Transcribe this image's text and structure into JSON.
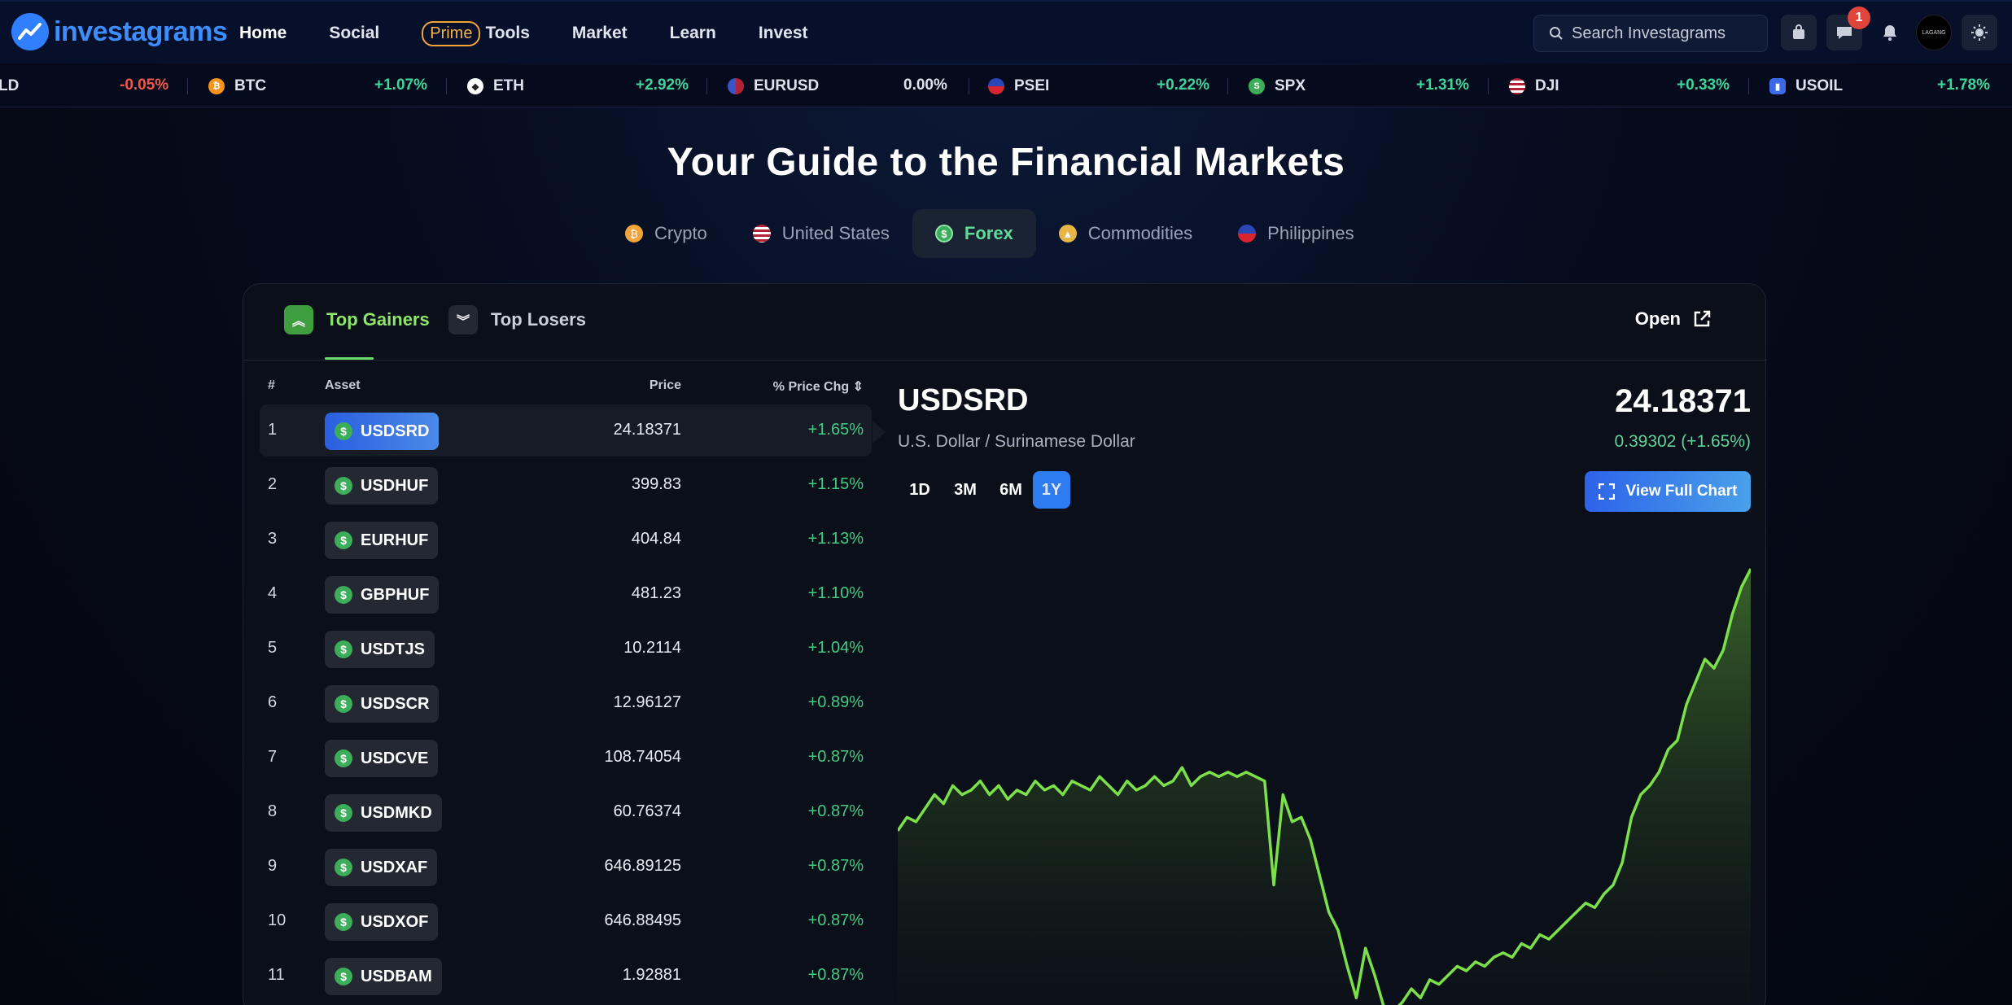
{
  "header": {
    "logo_text": "investagrams",
    "nav": [
      "Home",
      "Social",
      "Prime",
      "Tools",
      "Market",
      "Learn",
      "Invest"
    ],
    "search_placeholder": "Search Investagrams",
    "notification_count": "1",
    "avatar_text": "LAGANG"
  },
  "ticker": [
    {
      "symbol": "LD",
      "change": "-0.05%",
      "icon": "gold-icon",
      "color": "#f0584a"
    },
    {
      "symbol": "BTC",
      "change": "+1.07%",
      "icon": "bitcoin-icon",
      "color": "#f7931a"
    },
    {
      "symbol": "ETH",
      "change": "+2.92%",
      "icon": "ethereum-icon",
      "color": "#ffffff"
    },
    {
      "symbol": "EURUSD",
      "change": "0.00%",
      "icon": "eu-flag-icon",
      "color": "#3a54c8"
    },
    {
      "symbol": "PSEI",
      "change": "+0.22%",
      "icon": "ph-flag-icon",
      "color": "#d8242e"
    },
    {
      "symbol": "SPX",
      "change": "+1.31%",
      "icon": "sp-icon",
      "color": "#3cae5a"
    },
    {
      "symbol": "DJI",
      "change": "+0.33%",
      "icon": "us-flag-icon",
      "color": "#b22234"
    },
    {
      "symbol": "USOIL",
      "change": "+1.78%",
      "icon": "oil-icon",
      "color": "#3a6ae8"
    }
  ],
  "hero": {
    "title": "Your Guide to the Financial Markets"
  },
  "market_tabs": [
    {
      "label": "Crypto",
      "icon": "bitcoin-icon",
      "color": "#f2a33a"
    },
    {
      "label": "United States",
      "icon": "us-flag-icon",
      "color": "#b22234"
    },
    {
      "label": "Forex",
      "icon": "dollar-icon",
      "color": "#3cae5a",
      "active": true
    },
    {
      "label": "Commodities",
      "icon": "gold-icon",
      "color": "#e6b646"
    },
    {
      "label": "Philippines",
      "icon": "ph-flag-icon",
      "color": "#d8242e"
    }
  ],
  "panel": {
    "tabs": [
      "Top Gainers",
      "Top Losers"
    ],
    "open_label": "Open",
    "table_headers": {
      "num": "#",
      "asset": "Asset",
      "price": "Price",
      "chg": "% Price Chg"
    },
    "rows": [
      {
        "num": "1",
        "asset": "USDSRD",
        "price": "24.18371",
        "chg": "+1.65%"
      },
      {
        "num": "2",
        "asset": "USDHUF",
        "price": "399.83",
        "chg": "+1.15%"
      },
      {
        "num": "3",
        "asset": "EURHUF",
        "price": "404.84",
        "chg": "+1.13%"
      },
      {
        "num": "4",
        "asset": "GBPHUF",
        "price": "481.23",
        "chg": "+1.10%"
      },
      {
        "num": "5",
        "asset": "USDTJS",
        "price": "10.2114",
        "chg": "+1.04%"
      },
      {
        "num": "6",
        "asset": "USDSCR",
        "price": "12.96127",
        "chg": "+0.89%"
      },
      {
        "num": "7",
        "asset": "USDCVE",
        "price": "108.74054",
        "chg": "+0.87%"
      },
      {
        "num": "8",
        "asset": "USDMKD",
        "price": "60.76374",
        "chg": "+0.87%"
      },
      {
        "num": "9",
        "asset": "USDXAF",
        "price": "646.89125",
        "chg": "+0.87%"
      },
      {
        "num": "10",
        "asset": "USDXOF",
        "price": "646.88495",
        "chg": "+0.87%"
      },
      {
        "num": "11",
        "asset": "USDBAM",
        "price": "1.92881",
        "chg": "+0.87%"
      }
    ],
    "detail": {
      "symbol": "USDSRD",
      "name": "U.S. Dollar / Surinamese Dollar",
      "price": "24.18371",
      "change": "0.39302 (+1.65%)",
      "ranges": [
        "1D",
        "3M",
        "6M",
        "1Y"
      ],
      "active_range": "1Y",
      "view_full_chart": "View Full Chart"
    }
  },
  "chart_data": {
    "type": "area",
    "color": "#7be04a",
    "series": [
      {
        "values": [
          0.42,
          0.45,
          0.44,
          0.47,
          0.5,
          0.48,
          0.52,
          0.5,
          0.51,
          0.53,
          0.5,
          0.52,
          0.49,
          0.51,
          0.5,
          0.53,
          0.51,
          0.52,
          0.5,
          0.53,
          0.52,
          0.51,
          0.54,
          0.52,
          0.5,
          0.53,
          0.51,
          0.52,
          0.54,
          0.52,
          0.53,
          0.56,
          0.52,
          0.54,
          0.55,
          0.54,
          0.55,
          0.54,
          0.55,
          0.54,
          0.53,
          0.3,
          0.5,
          0.44,
          0.45,
          0.4,
          0.32,
          0.24,
          0.2,
          0.12,
          0.05,
          0.16,
          0.1,
          0.03,
          0.02,
          0.04,
          0.07,
          0.05,
          0.09,
          0.08,
          0.1,
          0.12,
          0.11,
          0.13,
          0.12,
          0.14,
          0.15,
          0.14,
          0.17,
          0.16,
          0.19,
          0.18,
          0.2,
          0.22,
          0.24,
          0.26,
          0.25,
          0.28,
          0.3,
          0.35,
          0.45,
          0.5,
          0.52,
          0.55,
          0.6,
          0.62,
          0.7,
          0.75,
          0.8,
          0.78,
          0.82,
          0.9,
          0.96,
          1.0
        ]
      }
    ]
  }
}
